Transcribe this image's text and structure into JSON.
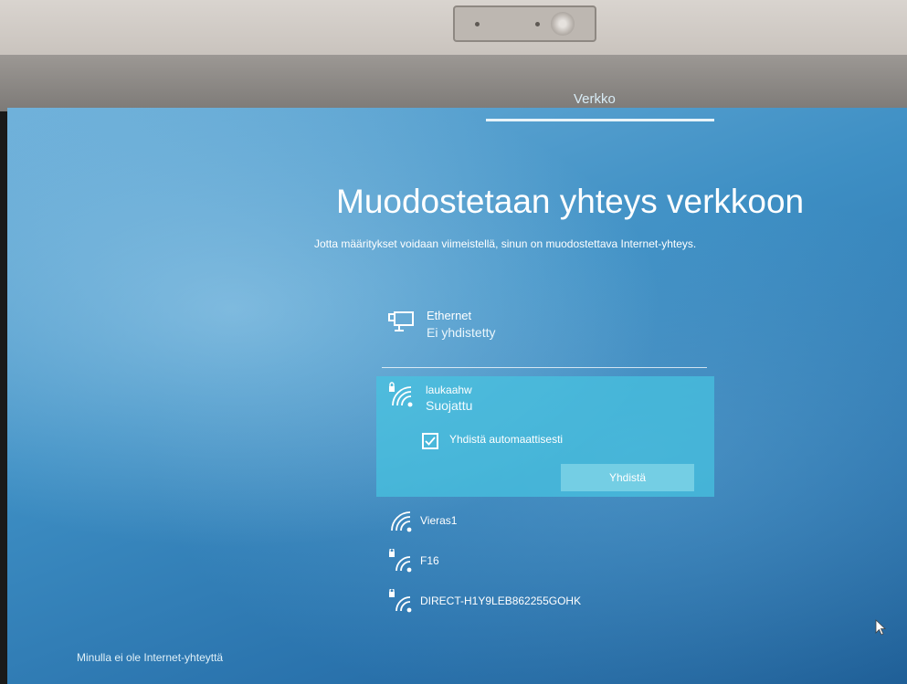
{
  "header": {
    "tab_title": "Verkko"
  },
  "main": {
    "heading": "Muodostetaan yhteys verkkoon",
    "subheading": "Jotta määritykset voidaan viimeistellä, sinun on muodostettava Internet-yhteys."
  },
  "ethernet": {
    "name": "Ethernet",
    "status": "Ei yhdistetty",
    "icon": "ethernet-icon"
  },
  "selected_network": {
    "name": "laukaahw",
    "status": "Suojattu",
    "auto_connect_label": "Yhdistä automaattisesti",
    "auto_connect_checked": true,
    "connect_label": "Yhdistä",
    "icon": "wifi-secured-icon"
  },
  "networks": [
    {
      "name": "Vieras1",
      "icon": "wifi-icon"
    },
    {
      "name": "F16",
      "icon": "wifi-secured-icon"
    },
    {
      "name": "DIRECT-H1Y9LEB862255GOHK",
      "icon": "wifi-secured-icon"
    }
  ],
  "footer": {
    "no_internet_link": "Minulla ei ole Internet-yhteyttä"
  },
  "colors": {
    "accent": "#46c3e1",
    "background": "#2a73ad",
    "text": "#ffffff"
  }
}
